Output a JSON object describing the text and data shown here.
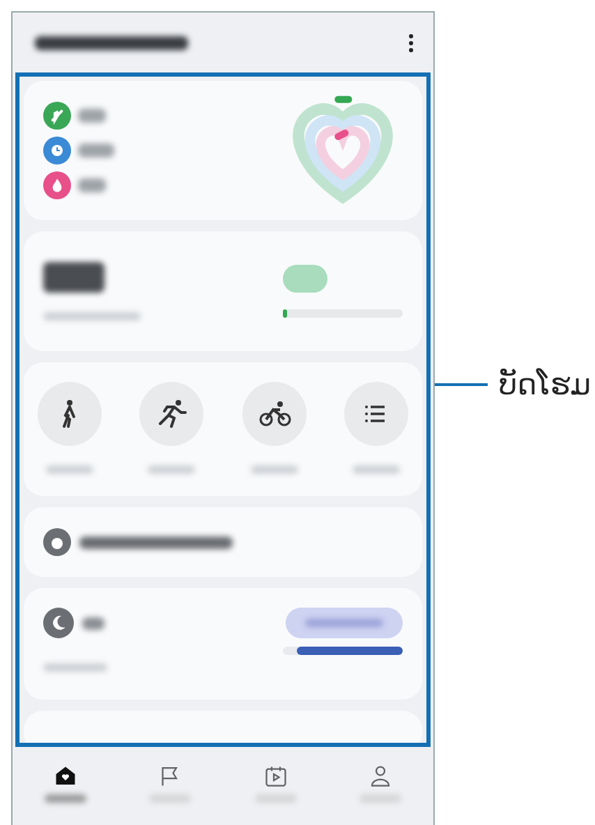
{
  "activity": [
    {
      "kind": "steps",
      "color": "#3aa757"
    },
    {
      "kind": "time",
      "color": "#3a8ad6"
    },
    {
      "kind": "calories",
      "color": "#e8508a"
    }
  ],
  "steps": {
    "level": 0.04
  },
  "exercises": [
    {
      "kind": "walk"
    },
    {
      "kind": "run"
    },
    {
      "kind": "bike"
    },
    {
      "kind": "list"
    }
  ],
  "sleep": {
    "level": 0.88
  },
  "nav": [
    {
      "kind": "home",
      "selected": true
    },
    {
      "kind": "flag",
      "selected": false
    },
    {
      "kind": "video",
      "selected": false
    },
    {
      "kind": "person",
      "selected": false
    }
  ],
  "callout": {
    "label": "ບັດໂຮມ"
  }
}
